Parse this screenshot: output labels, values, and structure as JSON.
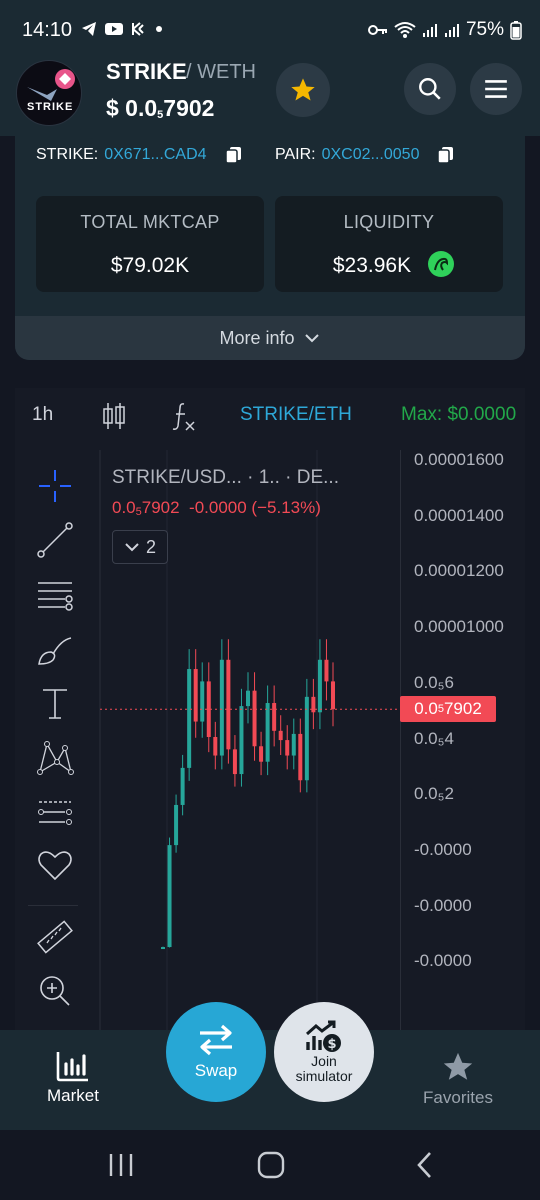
{
  "status_bar": {
    "time": "14:10",
    "battery": "75%"
  },
  "header": {
    "token_symbol": "STRIKE",
    "pair_suffix": "/ WETH",
    "price_prefix": "$ 0.0",
    "price_sub": "5",
    "price_rest": "7902",
    "logo_text": "STRIKE"
  },
  "info": {
    "strike_label": "STRIKE:",
    "strike_address": "0X671...CAD4",
    "pair_label": "PAIR:",
    "pair_address": "0XC02...0050",
    "mktcap_label": "TOTAL MKTCAP",
    "mktcap_value": "$79.02K",
    "liquidity_label": "LIQUIDITY",
    "liquidity_value": "$23.96K",
    "more_info": "More info"
  },
  "chart_toolbar": {
    "interval": "1h",
    "symbol": "STRIKE/ETH",
    "max": "Max: $0.0000"
  },
  "chart_legend": {
    "title": "STRIKE/USD...  · 1..  · DE...",
    "value_prefix": "0.0",
    "value_sub": "5",
    "value_rest": "7902",
    "change": "-0.0000 (−5.13%)",
    "collapse_count": "2"
  },
  "price_axis": {
    "ticks": [
      "0.00001600",
      "0.00001400",
      "0.00001200",
      "0.00001000",
      "0.0₅6",
      "0.0₅4",
      "0.0₅2",
      "-0.0000",
      "-0.0000",
      "-0.0000"
    ],
    "current_prefix": "0.0",
    "current_sub": "5",
    "current_rest": "7902"
  },
  "bottom_nav": {
    "market": "Market",
    "swap": "Swap",
    "simulator_line1": "Join",
    "simulator_line2": "simulator",
    "favorites": "Favorites"
  },
  "colors": {
    "accent": "#27a7d5",
    "up": "#26a69a",
    "down": "#f24a55",
    "star": "#f5b700",
    "max_green": "#22a84a"
  },
  "chart_data": {
    "type": "candlestick",
    "title": "STRIKE/USD",
    "ylim": [
      -2e-06,
      1.6e-05
    ],
    "closes": [
      2e-07,
      3.5e-06,
      4.8e-06,
      6e-06,
      9.2e-06,
      7.5e-06,
      8.8e-06,
      7e-06,
      6.4e-06,
      9.5e-06,
      6.6e-06,
      5.8e-06,
      8e-06,
      8.5e-06,
      6.7e-06,
      6.2e-06,
      8.1e-06,
      7.2e-06,
      6.9e-06,
      6.4e-06,
      7.1e-06,
      5.6e-06,
      8.3e-06,
      7.8e-06,
      9.5e-06,
      8.8e-06,
      7.9e-06
    ]
  }
}
